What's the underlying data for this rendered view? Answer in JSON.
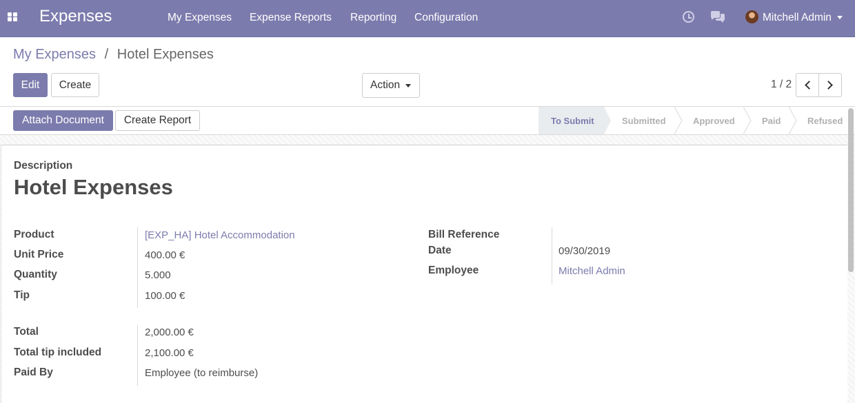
{
  "navbar": {
    "app_title": "Expenses",
    "menu": [
      "My Expenses",
      "Expense Reports",
      "Reporting",
      "Configuration"
    ],
    "user_name": "Mitchell Admin"
  },
  "breadcrumb": {
    "parent": "My Expenses",
    "separator": "/",
    "current": "Hotel Expenses"
  },
  "buttons": {
    "edit": "Edit",
    "create": "Create",
    "action": "Action",
    "attach_document": "Attach Document",
    "create_report": "Create Report"
  },
  "pager": {
    "value": "1 / 2"
  },
  "stages": [
    "To Submit",
    "Submitted",
    "Approved",
    "Paid",
    "Refused"
  ],
  "active_stage": "To Submit",
  "form": {
    "description_label": "Description",
    "description_value": "Hotel Expenses",
    "left_fields": [
      {
        "label": "Product",
        "value": "[EXP_HA] Hotel Accommodation"
      },
      {
        "label": "Unit Price",
        "value": "400.00 €"
      },
      {
        "label": "Quantity",
        "value": "5.000"
      },
      {
        "label": "Tip",
        "value": "100.00 €"
      },
      {
        "label": "Total",
        "value": "2,000.00 €"
      },
      {
        "label": "Total tip included",
        "value": "2,100.00 €"
      },
      {
        "label": "Paid By",
        "value": "Employee (to reimburse)"
      }
    ],
    "right_fields": [
      {
        "label": "Bill Reference",
        "value": ""
      },
      {
        "label": "Date",
        "value": "09/30/2019"
      },
      {
        "label": "Employee",
        "value": "Mitchell Admin"
      }
    ]
  },
  "colors": {
    "brand": "#7c7bad",
    "active_stage_bg": "#e9ecef",
    "inactive_stage_text": "#b0b0b0"
  },
  "icons": [
    "apps-grid-icon",
    "clock-icon",
    "chat-icon",
    "avatar",
    "chevron-left-icon",
    "chevron-right-icon",
    "caret-down-icon"
  ]
}
